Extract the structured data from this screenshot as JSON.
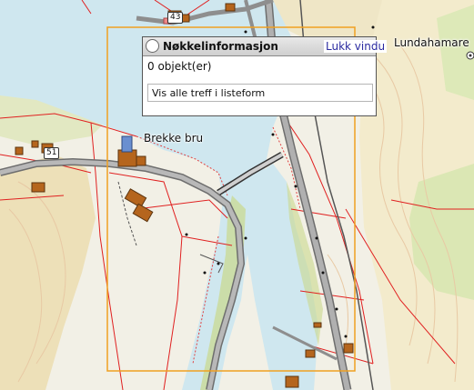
{
  "map": {
    "place_labels": {
      "lundahamare": "Lundahamare",
      "brekke_bru": "Brekke bru"
    },
    "road_shields": {
      "top": "43",
      "left": "51"
    },
    "colors": {
      "water": "#cfe7ef",
      "land": "#f2f0e6",
      "hill": "#ede4c4",
      "forest": "#d9e6b0",
      "road": "#8e8e8e",
      "building": "#b5651d",
      "parcel": "#e02020",
      "selection": "#f0a020"
    }
  },
  "info_panel": {
    "title": "Nøkkelinformasjon",
    "close_label": "Lukk vindu",
    "count_text": "0 objekt(er)",
    "list_button_label": "Vis alle treff i listeform"
  }
}
